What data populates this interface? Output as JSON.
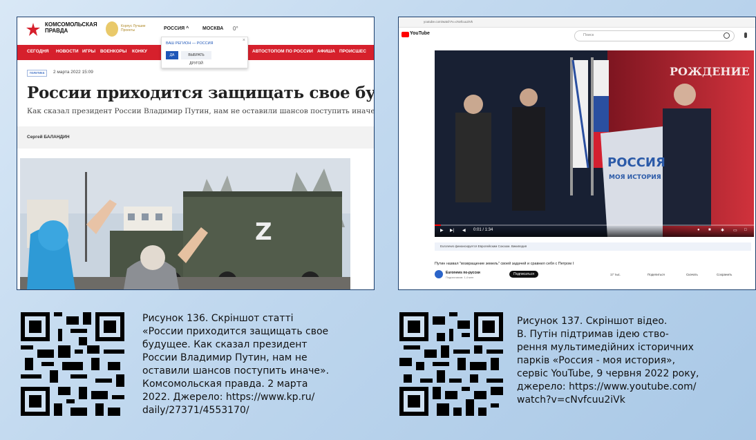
{
  "panel_kp": {
    "logo_text": "КОМСОМОЛЬСКАЯ ПРАВДА",
    "award_text": "Корпус Лучшие Проекты",
    "region": "РОССИЯ ^",
    "city": "МОСКВА",
    "weather": "0°",
    "popup": {
      "region_label": "ВАШ РЕГИОН — РОССИЯ",
      "yes_label": "ДА",
      "other_label": "ВЫБРАТЬ ДРУГОЙ",
      "close": "×"
    },
    "nav": [
      "СЕГОДНЯ",
      "НОВОСТИ",
      "ИГРЫ",
      "ВОЕНКОРЫ",
      "КОНКУ",
      "АВТОСТОПОМ ПО РОССИИ",
      "АФИША",
      "ПРОИСШЕС"
    ],
    "tag": "политика",
    "date": "2 марта 2022 15:09",
    "title": "России приходится защищать свое будущее",
    "subtitle": "Как сказал президент России Владимир Путин, нам не оставили шансов поступить иначе",
    "author": "Сергей БАЛАНДИН",
    "photo_letter": "Z"
  },
  "panel_yt": {
    "url": "youtube.com/watch?v=cNvfcuu2iVk",
    "logo_text": "YouTube",
    "search_placeholder": "Поиск",
    "banner_text": "РОЖДЕНИЕ ИМ",
    "podium_text_1": "РОССИЯ",
    "podium_text_2": "МОЯ ИСТОРИЯ",
    "time": "0:01 / 1:34",
    "info_text": "Euronews финансируется Европейским Союзом. Википедия",
    "video_title": "Путин назвал \"возвращение земель\" своей задачей и сравнил себя с Петром I",
    "channel": "Euronews по-русски",
    "subscribers": "Подписчиков: 1,4 млн",
    "subscribe": "Подписаться",
    "actions": [
      "17 тыс.",
      "Поделиться",
      "Скачать",
      "Сохранить"
    ]
  },
  "caption_136": {
    "lines": [
      "Рисунок 136. Скріншот статті",
      "«России приходится защищать свое",
      "будущее. Как сказал президент",
      "России Владимир Путин, нам не",
      "оставили шансов поступить иначе».",
      "Комсомольская правда. 2 марта",
      "2022. Джерело: https://www.kp.ru/",
      "daily/27371/4553170/"
    ]
  },
  "caption_137": {
    "lines": [
      "Рисунок 137. Скріншот відео.",
      "В. Путін підтримав ідею ство-",
      "рення мультимедійних історичних",
      "парків «Россия - моя история»,",
      "сервіс YouTube, 9 червня 2022 року,",
      "джерело: https://www.youtube.com/",
      "watch?v=cNvfcuu2iVk"
    ]
  },
  "colors": {
    "kp_red": "#d6202c",
    "frame_border": "#1a3d6b",
    "yt_red": "#ff0000"
  },
  "icons": [
    "kp-logo-icon",
    "qr-code-icon",
    "youtube-logo-icon",
    "search-icon",
    "mic-icon",
    "play-icon"
  ]
}
